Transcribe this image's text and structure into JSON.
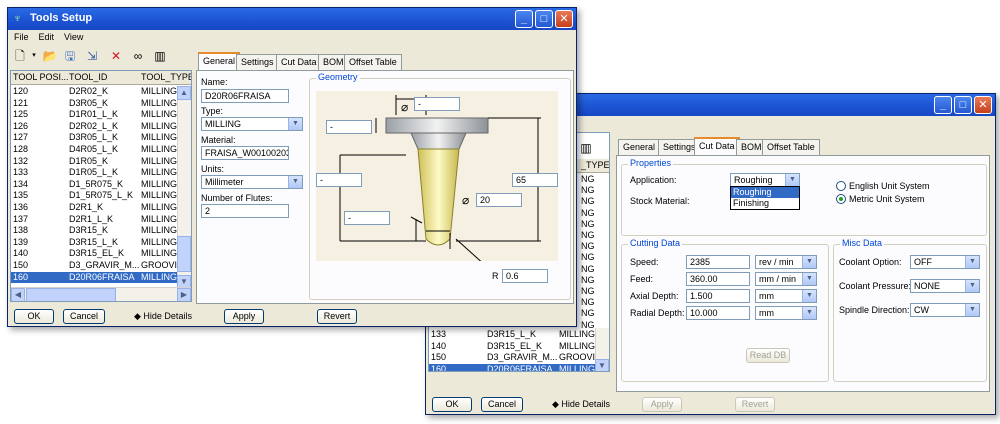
{
  "window1": {
    "title": "Tools Setup",
    "menu": [
      "File",
      "Edit",
      "View"
    ],
    "list": {
      "columns": [
        "TOOL POSI...",
        "TOOL_ID",
        "TOOL_TYPE"
      ],
      "rows": [
        [
          "120",
          "D2R02_K",
          "MILLING"
        ],
        [
          "121",
          "D3R05_K",
          "MILLING"
        ],
        [
          "125",
          "D1R01_L_K",
          "MILLING"
        ],
        [
          "126",
          "D2R02_L_K",
          "MILLING"
        ],
        [
          "127",
          "D3R05_L_K",
          "MILLING"
        ],
        [
          "128",
          "D4R05_L_K",
          "MILLING"
        ],
        [
          "132",
          "D1R05_K",
          "MILLING"
        ],
        [
          "133",
          "D1R05_L_K",
          "MILLING"
        ],
        [
          "134",
          "D1_5R075_K",
          "MILLING"
        ],
        [
          "135",
          "D1_5R075_L_K",
          "MILLING"
        ],
        [
          "136",
          "D2R1_K",
          "MILLING"
        ],
        [
          "137",
          "D2R1_L_K",
          "MILLING"
        ],
        [
          "138",
          "D3R15_K",
          "MILLING"
        ],
        [
          "139",
          "D3R15_L_K",
          "MILLING"
        ],
        [
          "140",
          "D3R15_EL_K",
          "MILLING"
        ],
        [
          "150",
          "D3_GRAVIR_M...",
          "GROOVIN"
        ],
        [
          "160",
          "D20R06FRAISA",
          "MILLING"
        ]
      ]
    },
    "tabs": [
      "General",
      "Settings",
      "Cut Data",
      "BOM",
      "Offset Table"
    ],
    "general": {
      "name_label": "Name:",
      "name_value": "D20R06FRAISA",
      "type_label": "Type:",
      "type_value": "MILLING",
      "material_label": "Material:",
      "material_value": "FRAISA_W00100203",
      "units_label": "Units:",
      "units_value": "Millimeter",
      "flutes_label": "Number of Flutes:",
      "flutes_value": "2"
    },
    "geometry": {
      "title": "Geometry",
      "top_diameter": "-",
      "head_height": "-",
      "total_length": "-",
      "cut_length": "-",
      "length": "65",
      "diameter": "20",
      "radius_label": "R",
      "radius": "0.6"
    },
    "buttons": {
      "ok": "OK",
      "cancel": "Cancel",
      "hide": "Hide Details",
      "apply": "Apply",
      "revert": "Revert"
    }
  },
  "window2": {
    "tabs": [
      "General",
      "Settings",
      "Cut Data",
      "BOM",
      "Offset Table"
    ],
    "partial_column": "_TYPE",
    "partial_rows": [
      "NG",
      "NG",
      "NG",
      "NG",
      "NG",
      "NG",
      "NG",
      "NG",
      "NG",
      "NG",
      "NG",
      "NG",
      "NG",
      "NG"
    ],
    "visible_rows": [
      [
        "133",
        "D3R15_L_K",
        "MILLING"
      ],
      [
        "140",
        "D3R15_EL_K",
        "MILLING"
      ],
      [
        "150",
        "D3_GRAVIR_M...",
        "GROOVIN"
      ],
      [
        "160",
        "D20R06FRAISA",
        "MILLING"
      ]
    ],
    "properties": {
      "title": "Properties",
      "application_label": "Application:",
      "application_value": "Roughing",
      "application_options": [
        "Roughing",
        "Finishing"
      ],
      "stock_label": "Stock Material:",
      "english": "English Unit System",
      "metric": "Metric Unit System"
    },
    "cutting": {
      "title": "Cutting Data",
      "speed_label": "Speed:",
      "speed_value": "2385",
      "speed_unit": "rev / min",
      "feed_label": "Feed:",
      "feed_value": "360.00",
      "feed_unit": "mm / min",
      "axial_label": "Axial Depth:",
      "axial_value": "1.500",
      "axial_unit": "mm",
      "radial_label": "Radial Depth:",
      "radial_value": "10.000",
      "radial_unit": "mm",
      "readdb": "Read DB"
    },
    "misc": {
      "title": "Misc Data",
      "coolant_label": "Coolant Option:",
      "coolant_value": "OFF",
      "pressure_label": "Coolant Pressure:",
      "pressure_value": "NONE",
      "spindle_label": "Spindle Direction:",
      "spindle_value": "CW"
    },
    "buttons": {
      "ok": "OK",
      "cancel": "Cancel",
      "hide": "Hide Details",
      "apply": "Apply",
      "revert": "Revert"
    }
  }
}
